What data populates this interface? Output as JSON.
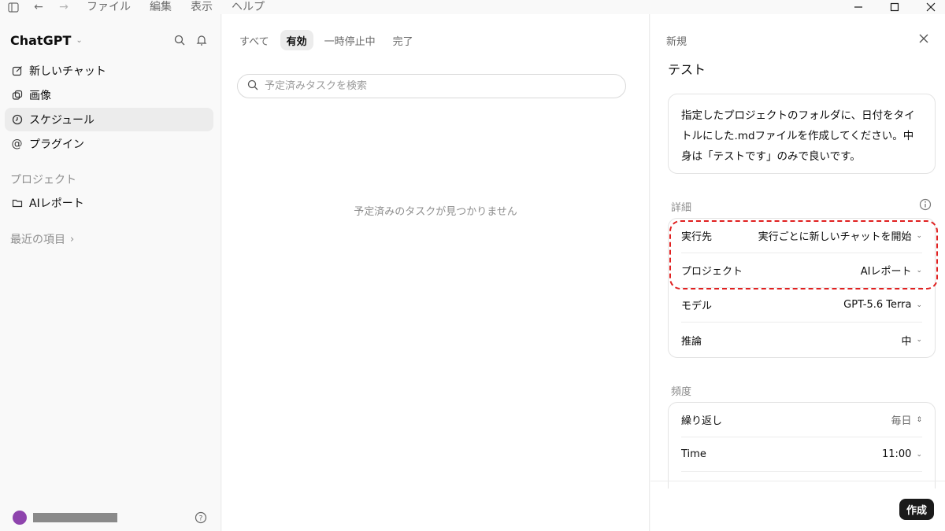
{
  "menu": [
    "ファイル",
    "編集",
    "表示",
    "ヘルプ"
  ],
  "sidebar": {
    "brand": "ChatGPT",
    "items": [
      {
        "label": "新しいチャット",
        "icon": "edit-icon"
      },
      {
        "label": "画像",
        "icon": "image-icon"
      },
      {
        "label": "スケジュール",
        "icon": "clock-icon",
        "active": true
      },
      {
        "label": "プラグイン",
        "icon": "at-icon"
      }
    ],
    "projects_label": "プロジェクト",
    "project_item": "AIレポート",
    "recent_label": "最近の項目"
  },
  "main": {
    "tabs": [
      "すべて",
      "有効",
      "一時停止中",
      "完了"
    ],
    "active_tab": "有効",
    "search_placeholder": "予定済みタスクを検索",
    "empty_message": "予定済みのタスクが見つかりません"
  },
  "panel": {
    "header": "新規",
    "task_title": "テスト",
    "prompt": "指定したプロジェクトのフォルダに、日付をタイトルにした.mdファイルを作成してください。中身は「テストです」のみで良いです。",
    "details_label": "詳細",
    "details": [
      {
        "label": "実行先",
        "value": "実行ごとに新しいチャットを開始"
      },
      {
        "label": "プロジェクト",
        "value": "AIレポート"
      },
      {
        "label": "モデル",
        "value": "GPT-5.6 Terra"
      },
      {
        "label": "推論",
        "value": "中"
      }
    ],
    "frequency_label": "頻度",
    "frequency": [
      {
        "label": "繰り返し",
        "value": "毎日"
      },
      {
        "label": "Time",
        "value": "11:00"
      }
    ],
    "create_button": "作成"
  },
  "colors": {
    "highlight": "#e02020",
    "avatar": "#8e44ad",
    "button": "#1a1a1a"
  }
}
